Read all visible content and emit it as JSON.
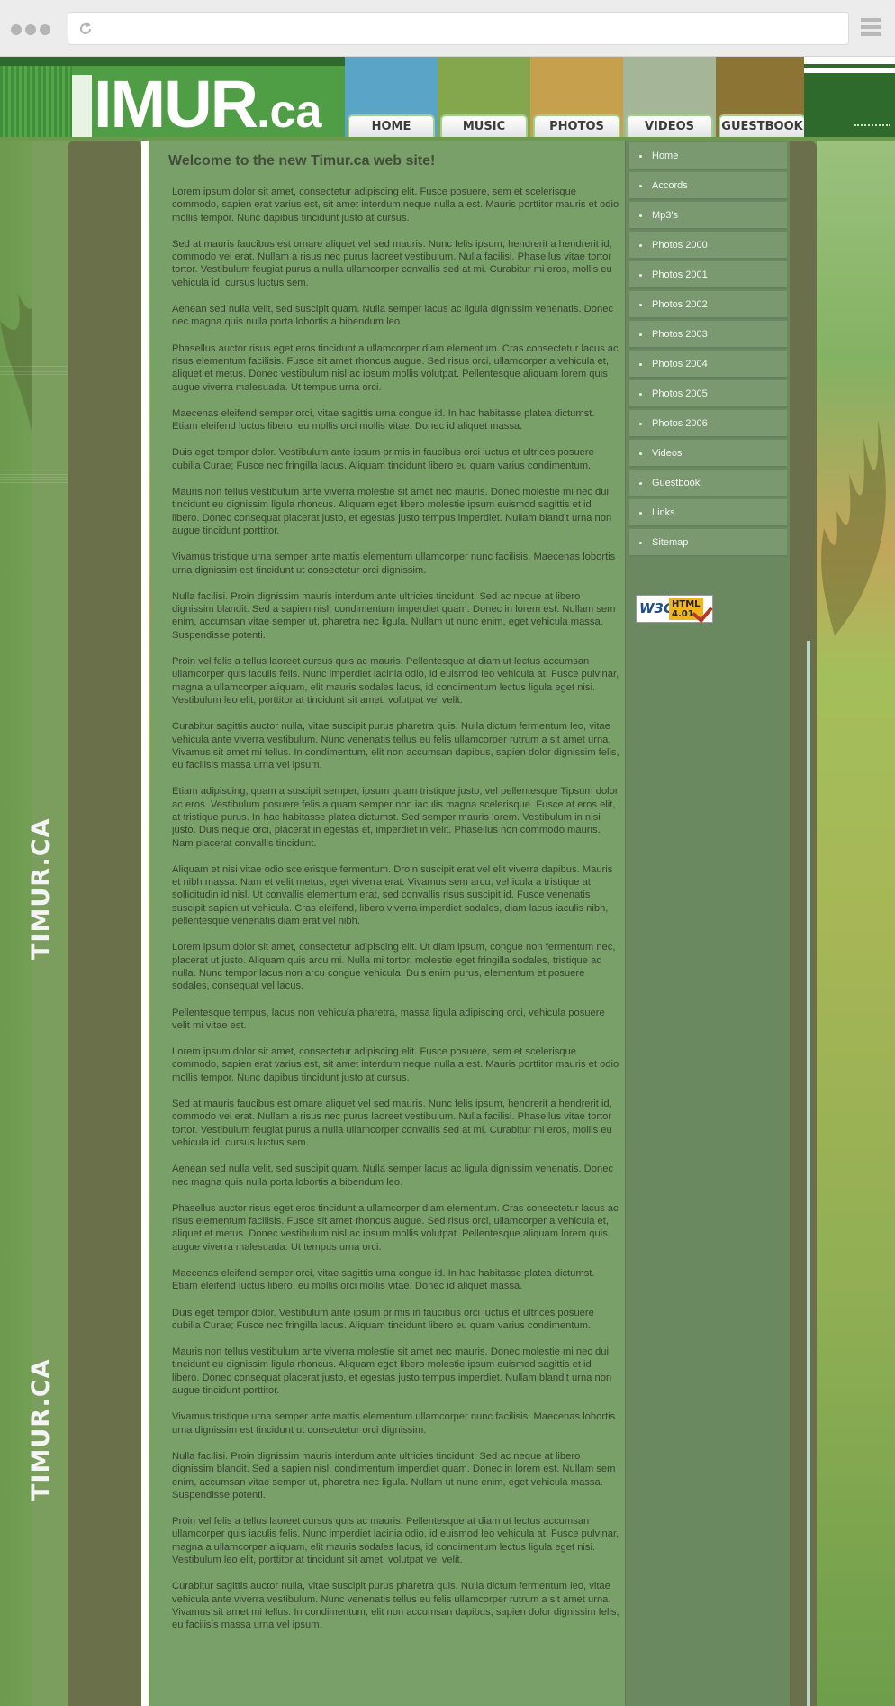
{
  "browser": {
    "menu_icon": "hamburger-icon",
    "reload_icon": "reload-icon"
  },
  "header": {
    "logo_main": "IMUR",
    "logo_suffix": ".ca",
    "nav": [
      {
        "label": "HOME",
        "color": "#5aa4c8"
      },
      {
        "label": "MUSIC",
        "color": "#84a64c"
      },
      {
        "label": "PHOTOS",
        "color": "#c6a04d"
      },
      {
        "label": "VIDEOS",
        "color": "#a4b598"
      },
      {
        "label": "GUESTBOOK",
        "color": "#8b7434"
      }
    ]
  },
  "side_logo": [
    "TIMUR.CA",
    "TIMUR.CA"
  ],
  "main": {
    "title": "Welcome to the new Timur.ca web site!",
    "paragraphs": [
      "Lorem ipsum dolor sit amet, consectetur adipiscing elit. Fusce posuere, sem et scelerisque commodo, sapien erat varius est, sit amet interdum neque nulla a est. Mauris porttitor mauris et odio mollis tempor. Nunc dapibus tincidunt justo at cursus.",
      "Sed at mauris faucibus est ornare aliquet vel sed mauris. Nunc felis ipsum, hendrerit a hendrerit id, commodo vel erat. Nullam a risus nec purus laoreet vestibulum. Nulla facilisi. Phasellus vitae tortor tortor. Vestibulum feugiat purus a nulla ullamcorper convallis sed at mi. Curabitur mi eros, mollis eu vehicula id, cursus luctus sem.",
      "Aenean sed nulla velit, sed suscipit quam. Nulla semper lacus ac ligula dignissim venenatis. Donec nec magna quis nulla porta lobortis a bibendum leo.",
      "Phasellus auctor risus eget eros tincidunt a ullamcorper diam elementum. Cras consectetur lacus ac risus elementum facilisis. Fusce sit amet rhoncus augue. Sed risus orci, ullamcorper a vehicula et, aliquet et metus. Donec vestibulum nisl ac ipsum mollis volutpat. Pellentesque aliquam lorem quis augue viverra malesuada. Ut tempus urna orci.",
      "Maecenas eleifend semper orci, vitae sagittis urna congue id. In hac habitasse platea dictumst. Etiam eleifend luctus libero, eu mollis orci mollis vitae. Donec id aliquet massa.",
      "Duis eget tempor dolor. Vestibulum ante ipsum primis in faucibus orci luctus et ultrices posuere cubilia Curae; Fusce nec fringilla lacus. Aliquam tincidunt libero eu quam varius condimentum.",
      "Mauris non tellus vestibulum ante viverra molestie sit amet nec mauris. Donec molestie mi nec dui tincidunt eu dignissim ligula rhoncus. Aliquam eget libero molestie ipsum euismod sagittis et id libero. Donec consequat placerat justo, et egestas justo tempus imperdiet. Nullam blandit urna non augue tincidunt porttitor.",
      "Vivamus tristique urna semper ante mattis elementum ullamcorper nunc facilisis. Maecenas lobortis urna dignissim est tincidunt ut consectetur orci dignissim.",
      "Nulla facilisi. Proin dignissim mauris interdum ante ultricies tincidunt. Sed ac neque at libero dignissim blandit. Sed a sapien nisl, condimentum imperdiet quam. Donec in lorem est. Nullam sem enim, accumsan vitae semper ut, pharetra nec ligula. Nullam ut nunc enim, eget vehicula massa. Suspendisse potenti.",
      "Proin vel felis a tellus laoreet cursus quis ac mauris. Pellentesque at diam ut lectus accumsan ullamcorper quis iaculis felis. Nunc imperdiet lacinia odio, id euismod leo vehicula at. Fusce pulvinar, magna a ullamcorper aliquam, elit mauris sodales lacus, id condimentum lectus ligula eget nisi. Vestibulum leo elit, porttitor at tincidunt sit amet, volutpat vel velit.",
      "Curabitur sagittis auctor nulla, vitae suscipit purus pharetra quis. Nulla dictum fermentum leo, vitae vehicula ante viverra vestibulum. Nunc venenatis tellus eu felis ullamcorper rutrum a sit amet urna. Vivamus sit amet mi tellus. In condimentum, elit non accumsan dapibus, sapien dolor dignissim felis, eu facilisis massa urna vel ipsum.",
      "Etiam adipiscing, quam a suscipit semper, ipsum quam tristique justo, vel pellentesque Tipsum dolor ac eros. Vestibulum posuere felis a quam semper non iaculis magna scelerisque. Fusce at eros elit, at tristique purus. In hac habitasse platea dictumst. Sed semper mauris lorem. Vestibulum in nisi justo. Duis neque orci, placerat in egestas et, imperdiet in velit. Phasellus non commodo mauris. Nam placerat convallis tincidunt.",
      "Aliquam et nisi vitae odio scelerisque fermentum. Droin suscipit erat vel elit viverra dapibus. Mauris et nibh massa. Nam et velit metus, eget viverra erat. Vivamus sem arcu, vehicula a tristique at, sollicitudin id nisl. Ut convallis elementum erat, sed convallis risus suscipit id. Fusce venenatis suscipit sapien ut vehicula. Cras eleifend, libero viverra imperdiet sodales, diam lacus iaculis nibh, pellentesque venenatis diam erat vel nibh.",
      "Lorem ipsum dolor sit amet, consectetur adipiscing elit. Ut diam ipsum, congue non fermentum nec, placerat ut justo. Aliquam quis arcu mi. Nulla mi tortor, molestie eget fringilla sodales, tristique ac nulla. Nunc tempor lacus non arcu congue vehicula. Duis enim purus, elementum et posuere sodales, consequat vel lacus.",
      "Pellentesque tempus, lacus non vehicula pharetra, massa ligula adipiscing orci, vehicula posuere velit mi vitae est.",
      "Lorem ipsum dolor sit amet, consectetur adipiscing elit. Fusce posuere, sem et scelerisque commodo, sapien erat varius est, sit amet interdum neque nulla a est. Mauris porttitor mauris et odio mollis tempor. Nunc dapibus tincidunt justo at cursus.",
      "Sed at mauris faucibus est ornare aliquet vel sed mauris. Nunc felis ipsum, hendrerit a hendrerit id, commodo vel erat. Nullam a risus nec purus laoreet vestibulum. Nulla facilisi. Phasellus vitae tortor tortor. Vestibulum feugiat purus a nulla ullamcorper convallis sed at mi. Curabitur mi eros, mollis eu vehicula id, cursus luctus sem.",
      "Aenean sed nulla velit, sed suscipit quam. Nulla semper lacus ac ligula dignissim venenatis. Donec nec magna quis nulla porta lobortis a bibendum leo.",
      "Phasellus auctor risus eget eros tincidunt a ullamcorper diam elementum. Cras consectetur lacus ac risus elementum facilisis. Fusce sit amet rhoncus augue. Sed risus orci, ullamcorper a vehicula et, aliquet et metus. Donec vestibulum nisl ac ipsum mollis volutpat. Pellentesque aliquam lorem quis augue viverra malesuada. Ut tempus urna orci.",
      "Maecenas eleifend semper orci, vitae sagittis urna congue id. In hac habitasse platea dictumst. Etiam eleifend luctus libero, eu mollis orci mollis vitae. Donec id aliquet massa.",
      "Duis eget tempor dolor. Vestibulum ante ipsum primis in faucibus orci luctus et ultrices posuere cubilia Curae; Fusce nec fringilla lacus. Aliquam tincidunt libero eu quam varius condimentum.",
      "Mauris non tellus vestibulum ante viverra molestie sit amet nec mauris. Donec molestie mi nec dui tincidunt eu dignissim ligula rhoncus. Aliquam eget libero molestie ipsum euismod sagittis et id libero. Donec consequat placerat justo, et egestas justo tempus imperdiet. Nullam blandit urna non augue tincidunt porttitor.",
      "Vivamus tristique urna semper ante mattis elementum ullamcorper nunc facilisis. Maecenas lobortis urna dignissim est tincidunt ut consectetur orci dignissim.",
      "Nulla facilisi. Proin dignissim mauris interdum ante ultricies tincidunt. Sed ac neque at libero dignissim blandit. Sed a sapien nisl, condimentum imperdiet quam. Donec in lorem est. Nullam sem enim, accumsan vitae semper ut, pharetra nec ligula. Nullam ut nunc enim, eget vehicula massa. Suspendisse potenti.",
      "Proin vel felis a tellus laoreet cursus quis ac mauris. Pellentesque at diam ut lectus accumsan ullamcorper quis iaculis felis. Nunc imperdiet lacinia odio, id euismod leo vehicula at. Fusce pulvinar, magna a ullamcorper aliquam, elit mauris sodales lacus, id condimentum lectus ligula eget nisi. Vestibulum leo elit, porttitor at tincidunt sit amet, volutpat vel velit.",
      "Curabitur sagittis auctor nulla, vitae suscipit purus pharetra quis. Nulla dictum fermentum leo, vitae vehicula ante viverra vestibulum. Nunc venenatis tellus eu felis ullamcorper rutrum a sit amet urna. Vivamus sit amet mi tellus. In condimentum, elit non accumsan dapibus, sapien dolor dignissim felis, eu facilisis massa urna vel ipsum."
    ]
  },
  "sidebar": {
    "items": [
      "Home",
      "Accords",
      "Mp3's",
      "Photos 2000",
      "Photos 2001",
      "Photos 2002",
      "Photos 2003",
      "Photos 2004",
      "Photos 2005",
      "Photos 2006",
      "Videos",
      "Guestbook",
      "Links",
      "Sitemap"
    ],
    "badge": {
      "w3c": "W3C",
      "html": "HTML",
      "version": "4.01"
    }
  }
}
